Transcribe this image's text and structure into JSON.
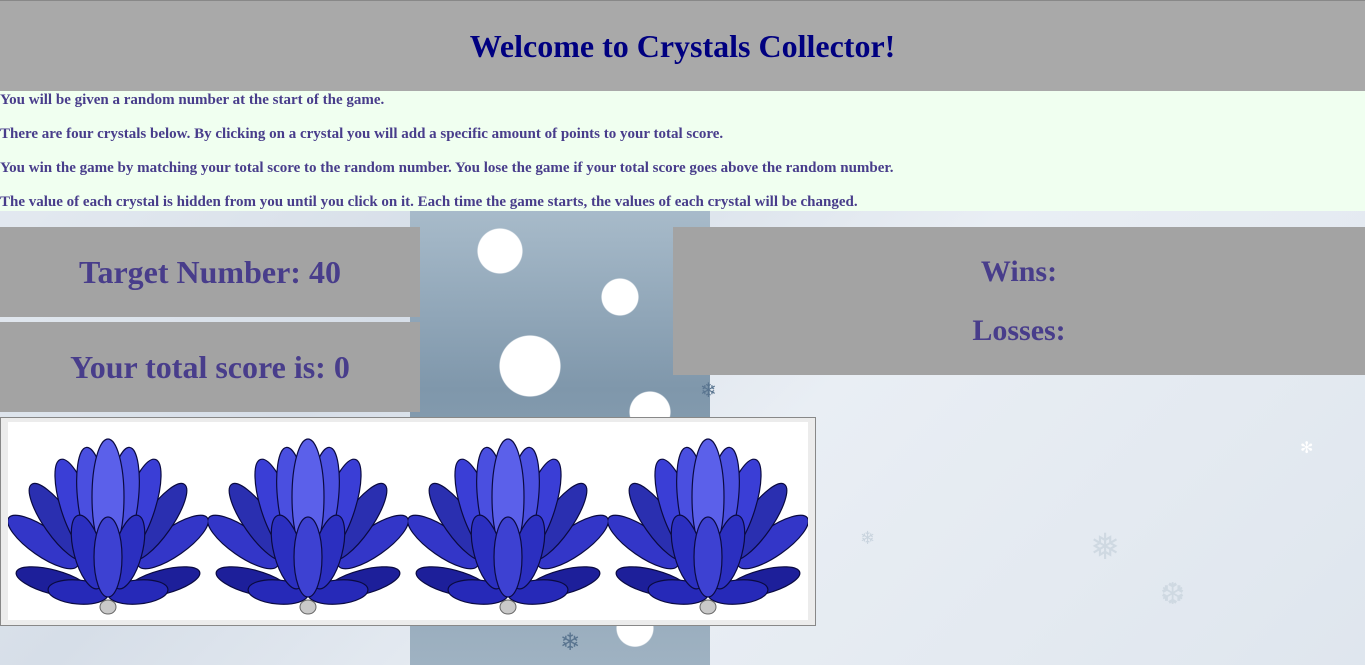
{
  "header": {
    "title": "Welcome to Crystals Collector!"
  },
  "instructions": [
    "You will be given a random number at the start of the game.",
    "There are four crystals below. By clicking on a crystal you will add a specific amount of points to your total score.",
    "You win the game by matching your total score to the random number. You lose the game if your total score goes above the random number.",
    "The value of each crystal is hidden from you until you click on it. Each time the game starts, the values of each crystal will be changed."
  ],
  "target": {
    "label": "Target Number: 40"
  },
  "score": {
    "label": "Your total score is: 0"
  },
  "record": {
    "wins_label": "Wins:",
    "losses_label": "Losses:"
  },
  "crystals": [
    {
      "icon": "blue-lotus-crystal-icon"
    },
    {
      "icon": "blue-lotus-crystal-icon"
    },
    {
      "icon": "blue-lotus-crystal-icon"
    },
    {
      "icon": "blue-lotus-crystal-icon"
    }
  ],
  "colors": {
    "header_bg": "#a9a9a9",
    "title": "#000080",
    "text": "#483d8b",
    "instructions_bg": "#f0fff0",
    "box_bg": "#a3a3a3",
    "crystal": "#2a2fb0"
  }
}
